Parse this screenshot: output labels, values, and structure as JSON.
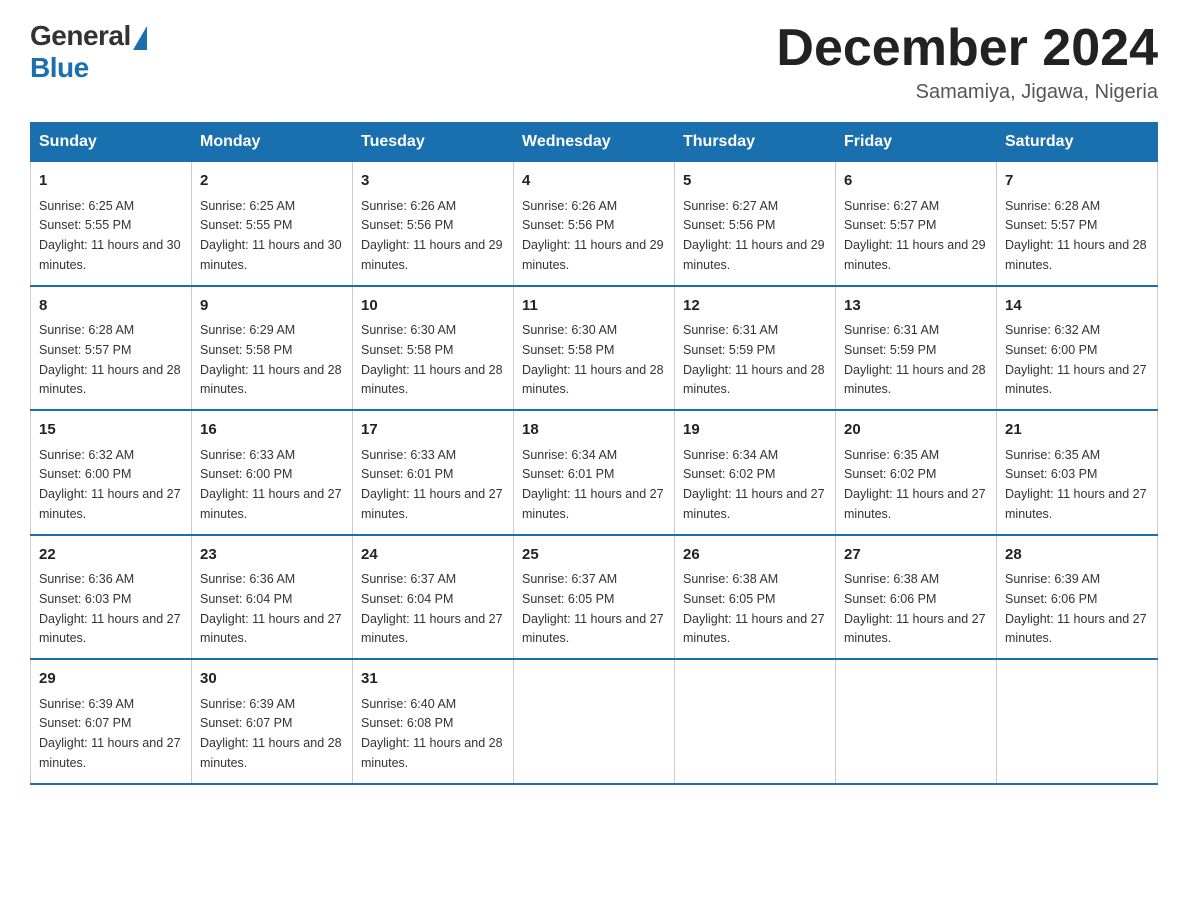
{
  "header": {
    "logo_general": "General",
    "logo_blue": "Blue",
    "month_title": "December 2024",
    "location": "Samamiya, Jigawa, Nigeria"
  },
  "days_of_week": [
    "Sunday",
    "Monday",
    "Tuesday",
    "Wednesday",
    "Thursday",
    "Friday",
    "Saturday"
  ],
  "weeks": [
    [
      {
        "day": "1",
        "sunrise": "6:25 AM",
        "sunset": "5:55 PM",
        "daylight": "11 hours and 30 minutes."
      },
      {
        "day": "2",
        "sunrise": "6:25 AM",
        "sunset": "5:55 PM",
        "daylight": "11 hours and 30 minutes."
      },
      {
        "day": "3",
        "sunrise": "6:26 AM",
        "sunset": "5:56 PM",
        "daylight": "11 hours and 29 minutes."
      },
      {
        "day": "4",
        "sunrise": "6:26 AM",
        "sunset": "5:56 PM",
        "daylight": "11 hours and 29 minutes."
      },
      {
        "day": "5",
        "sunrise": "6:27 AM",
        "sunset": "5:56 PM",
        "daylight": "11 hours and 29 minutes."
      },
      {
        "day": "6",
        "sunrise": "6:27 AM",
        "sunset": "5:57 PM",
        "daylight": "11 hours and 29 minutes."
      },
      {
        "day": "7",
        "sunrise": "6:28 AM",
        "sunset": "5:57 PM",
        "daylight": "11 hours and 28 minutes."
      }
    ],
    [
      {
        "day": "8",
        "sunrise": "6:28 AM",
        "sunset": "5:57 PM",
        "daylight": "11 hours and 28 minutes."
      },
      {
        "day": "9",
        "sunrise": "6:29 AM",
        "sunset": "5:58 PM",
        "daylight": "11 hours and 28 minutes."
      },
      {
        "day": "10",
        "sunrise": "6:30 AM",
        "sunset": "5:58 PM",
        "daylight": "11 hours and 28 minutes."
      },
      {
        "day": "11",
        "sunrise": "6:30 AM",
        "sunset": "5:58 PM",
        "daylight": "11 hours and 28 minutes."
      },
      {
        "day": "12",
        "sunrise": "6:31 AM",
        "sunset": "5:59 PM",
        "daylight": "11 hours and 28 minutes."
      },
      {
        "day": "13",
        "sunrise": "6:31 AM",
        "sunset": "5:59 PM",
        "daylight": "11 hours and 28 minutes."
      },
      {
        "day": "14",
        "sunrise": "6:32 AM",
        "sunset": "6:00 PM",
        "daylight": "11 hours and 27 minutes."
      }
    ],
    [
      {
        "day": "15",
        "sunrise": "6:32 AM",
        "sunset": "6:00 PM",
        "daylight": "11 hours and 27 minutes."
      },
      {
        "day": "16",
        "sunrise": "6:33 AM",
        "sunset": "6:00 PM",
        "daylight": "11 hours and 27 minutes."
      },
      {
        "day": "17",
        "sunrise": "6:33 AM",
        "sunset": "6:01 PM",
        "daylight": "11 hours and 27 minutes."
      },
      {
        "day": "18",
        "sunrise": "6:34 AM",
        "sunset": "6:01 PM",
        "daylight": "11 hours and 27 minutes."
      },
      {
        "day": "19",
        "sunrise": "6:34 AM",
        "sunset": "6:02 PM",
        "daylight": "11 hours and 27 minutes."
      },
      {
        "day": "20",
        "sunrise": "6:35 AM",
        "sunset": "6:02 PM",
        "daylight": "11 hours and 27 minutes."
      },
      {
        "day": "21",
        "sunrise": "6:35 AM",
        "sunset": "6:03 PM",
        "daylight": "11 hours and 27 minutes."
      }
    ],
    [
      {
        "day": "22",
        "sunrise": "6:36 AM",
        "sunset": "6:03 PM",
        "daylight": "11 hours and 27 minutes."
      },
      {
        "day": "23",
        "sunrise": "6:36 AM",
        "sunset": "6:04 PM",
        "daylight": "11 hours and 27 minutes."
      },
      {
        "day": "24",
        "sunrise": "6:37 AM",
        "sunset": "6:04 PM",
        "daylight": "11 hours and 27 minutes."
      },
      {
        "day": "25",
        "sunrise": "6:37 AM",
        "sunset": "6:05 PM",
        "daylight": "11 hours and 27 minutes."
      },
      {
        "day": "26",
        "sunrise": "6:38 AM",
        "sunset": "6:05 PM",
        "daylight": "11 hours and 27 minutes."
      },
      {
        "day": "27",
        "sunrise": "6:38 AM",
        "sunset": "6:06 PM",
        "daylight": "11 hours and 27 minutes."
      },
      {
        "day": "28",
        "sunrise": "6:39 AM",
        "sunset": "6:06 PM",
        "daylight": "11 hours and 27 minutes."
      }
    ],
    [
      {
        "day": "29",
        "sunrise": "6:39 AM",
        "sunset": "6:07 PM",
        "daylight": "11 hours and 27 minutes."
      },
      {
        "day": "30",
        "sunrise": "6:39 AM",
        "sunset": "6:07 PM",
        "daylight": "11 hours and 28 minutes."
      },
      {
        "day": "31",
        "sunrise": "6:40 AM",
        "sunset": "6:08 PM",
        "daylight": "11 hours and 28 minutes."
      },
      null,
      null,
      null,
      null
    ]
  ]
}
